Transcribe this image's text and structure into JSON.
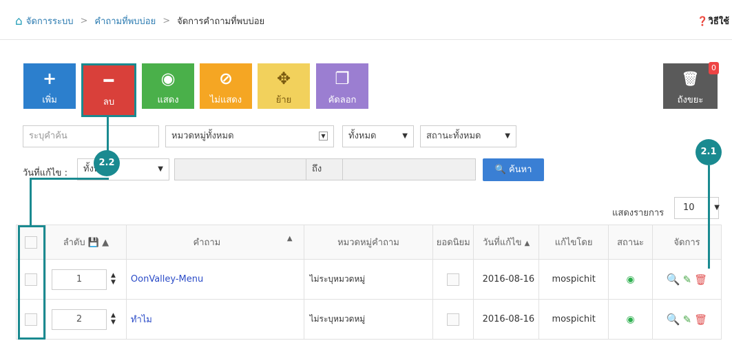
{
  "breadcrumb": {
    "items": [
      "จัดการระบบ",
      "คำถามที่พบบ่อย",
      "จัดการคำถามที่พบบ่อย"
    ],
    "separator": ">"
  },
  "help_label": "วิธีใช้",
  "toolbar": {
    "buttons": [
      {
        "label": "เพิ่ม",
        "icon": "plus-icon",
        "glyph": "+",
        "color": "#2c7fcd"
      },
      {
        "label": "ลบ",
        "icon": "minus-icon",
        "glyph": "━",
        "color": "#d9403a"
      },
      {
        "label": "แสดง",
        "icon": "eye-icon",
        "glyph": "◉",
        "color": "#4ab04a"
      },
      {
        "label": "ไม่แสดง",
        "icon": "eye-slash-icon",
        "glyph": "⊘",
        "color": "#f5a623"
      },
      {
        "label": "ย้าย",
        "icon": "move-icon",
        "glyph": "✥",
        "color": "#f2d15c"
      },
      {
        "label": "คัดลอก",
        "icon": "copy-icon",
        "glyph": "❐",
        "color": "#9b7ed1"
      }
    ],
    "trash": {
      "label": "ถังขยะ",
      "glyph": "🗑",
      "badge": "0",
      "color": "#5a5a5a"
    }
  },
  "filters": {
    "keyword_placeholder": "ระบุคำค้น",
    "category": "หมวดหมู่ทั้งหมด",
    "type": "ทั้งหมด",
    "status": "สถานะทั้งหมด",
    "date_label": "วันที่แก้ไข :",
    "date_select": "ทั้งหมด",
    "to_label": "ถึง",
    "search_label": "ค้นหา"
  },
  "list": {
    "show_label": "แสดงรายการ",
    "page_size": "10"
  },
  "table": {
    "headers": [
      "ลำดับ",
      "คำถาม",
      "หมวดหมู่คำถาม",
      "ยอดนิยม",
      "วันที่แก้ไข",
      "แก้ไขโดย",
      "สถานะ",
      "จัดการ"
    ],
    "rows": [
      {
        "order": "1",
        "question": "OonValley-Menu",
        "category": "ไม่ระบุหมวดหมู่",
        "date": "2016-08-16",
        "by": "mospichit"
      },
      {
        "order": "2",
        "question": "ทำไม",
        "category": "ไม่ระบุหมวดหมู่",
        "date": "2016-08-16",
        "by": "mospichit"
      }
    ]
  },
  "callouts": {
    "a": "2.2",
    "b": "2.1"
  },
  "colors": {
    "callout": "#1a8a90",
    "link": "#2a7ab0"
  }
}
